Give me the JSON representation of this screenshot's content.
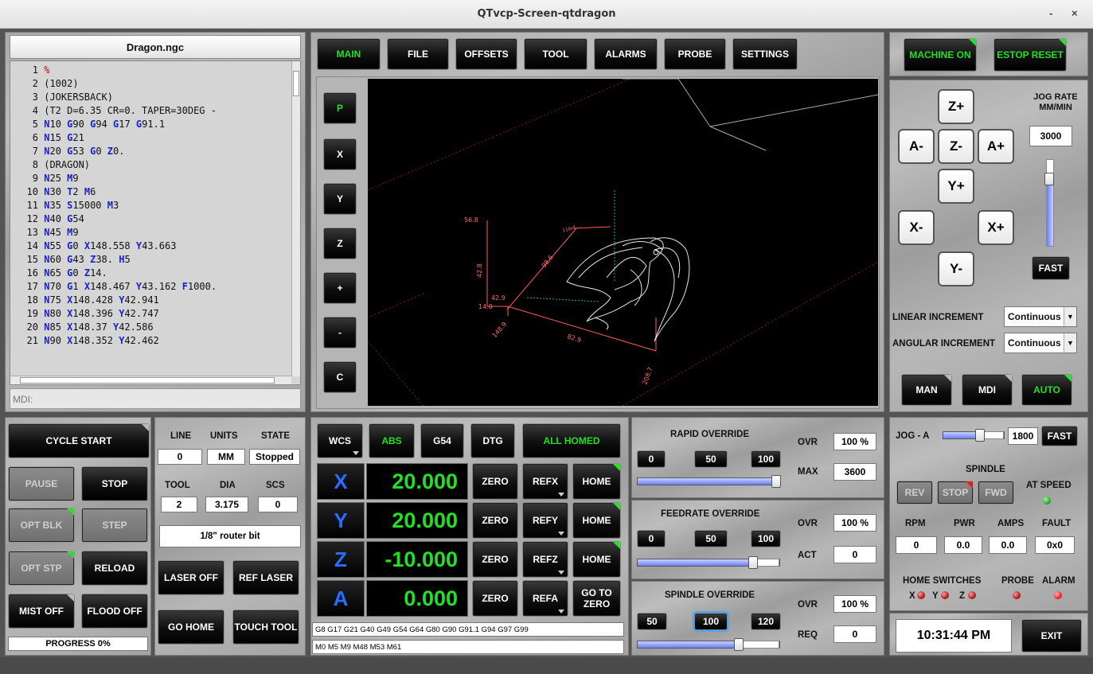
{
  "window": {
    "title": "QTvcp-Screen-qtdragon",
    "minimize": "-",
    "close": "×"
  },
  "gcode": {
    "filename": "Dragon.ngc",
    "lines": [
      {
        "n": "1",
        "t": [
          [
            "pct",
            "%"
          ]
        ]
      },
      {
        "n": "2",
        "t": [
          [
            "",
            "(1002)"
          ]
        ]
      },
      {
        "n": "3",
        "t": [
          [
            "",
            "(JOKERSBACK)"
          ]
        ]
      },
      {
        "n": "4",
        "t": [
          [
            "",
            "(T2  D=6.35 CR=0. TAPER=30DEG -"
          ]
        ]
      },
      {
        "n": "5",
        "t": [
          [
            "kw",
            "N"
          ],
          [
            "",
            "10 "
          ],
          [
            "kw",
            "G"
          ],
          [
            "",
            "90 "
          ],
          [
            "kw",
            "G"
          ],
          [
            "",
            "94 "
          ],
          [
            "kw",
            "G"
          ],
          [
            "",
            "17 "
          ],
          [
            "kw",
            "G"
          ],
          [
            "",
            "91.1"
          ]
        ]
      },
      {
        "n": "6",
        "t": [
          [
            "kw",
            "N"
          ],
          [
            "",
            "15 "
          ],
          [
            "kw",
            "G"
          ],
          [
            "",
            "21"
          ]
        ]
      },
      {
        "n": "7",
        "t": [
          [
            "kw",
            "N"
          ],
          [
            "",
            "20 "
          ],
          [
            "kw",
            "G"
          ],
          [
            "",
            "53 "
          ],
          [
            "kw",
            "G"
          ],
          [
            "",
            "0 "
          ],
          [
            "kw",
            "Z"
          ],
          [
            "",
            "0."
          ]
        ]
      },
      {
        "n": "8",
        "t": [
          [
            "",
            "(DRAGON)"
          ]
        ]
      },
      {
        "n": "9",
        "t": [
          [
            "kw",
            "N"
          ],
          [
            "",
            "25 "
          ],
          [
            "kw",
            "M"
          ],
          [
            "",
            "9"
          ]
        ]
      },
      {
        "n": "10",
        "t": [
          [
            "kw",
            "N"
          ],
          [
            "",
            "30 "
          ],
          [
            "kw",
            "T"
          ],
          [
            "",
            "2 "
          ],
          [
            "kw",
            "M"
          ],
          [
            "",
            "6"
          ]
        ]
      },
      {
        "n": "11",
        "t": [
          [
            "kw",
            "N"
          ],
          [
            "",
            "35 "
          ],
          [
            "kw",
            "S"
          ],
          [
            "",
            "15000 "
          ],
          [
            "kw",
            "M"
          ],
          [
            "",
            "3"
          ]
        ]
      },
      {
        "n": "12",
        "t": [
          [
            "kw",
            "N"
          ],
          [
            "",
            "40 "
          ],
          [
            "kw",
            "G"
          ],
          [
            "",
            "54"
          ]
        ]
      },
      {
        "n": "13",
        "t": [
          [
            "kw",
            "N"
          ],
          [
            "",
            "45 "
          ],
          [
            "kw",
            "M"
          ],
          [
            "",
            "9"
          ]
        ]
      },
      {
        "n": "14",
        "t": [
          [
            "kw",
            "N"
          ],
          [
            "",
            "55 "
          ],
          [
            "kw",
            "G"
          ],
          [
            "",
            "0 "
          ],
          [
            "kw",
            "X"
          ],
          [
            "",
            "148.558 "
          ],
          [
            "kw",
            "Y"
          ],
          [
            "",
            "43.663"
          ]
        ]
      },
      {
        "n": "15",
        "t": [
          [
            "kw",
            "N"
          ],
          [
            "",
            "60 "
          ],
          [
            "kw",
            "G"
          ],
          [
            "",
            "43 "
          ],
          [
            "kw",
            "Z"
          ],
          [
            "",
            "38. "
          ],
          [
            "kw",
            "H"
          ],
          [
            "",
            "5"
          ]
        ]
      },
      {
        "n": "16",
        "t": [
          [
            "kw",
            "N"
          ],
          [
            "",
            "65 "
          ],
          [
            "kw",
            "G"
          ],
          [
            "",
            "0 "
          ],
          [
            "kw",
            "Z"
          ],
          [
            "",
            "14."
          ]
        ]
      },
      {
        "n": "17",
        "t": [
          [
            "kw",
            "N"
          ],
          [
            "",
            "70 "
          ],
          [
            "kw",
            "G"
          ],
          [
            "",
            "1 "
          ],
          [
            "kw",
            "X"
          ],
          [
            "",
            "148.467 "
          ],
          [
            "kw",
            "Y"
          ],
          [
            "",
            "43.162 "
          ],
          [
            "kw",
            "F"
          ],
          [
            "",
            "1000."
          ]
        ]
      },
      {
        "n": "18",
        "t": [
          [
            "kw",
            "N"
          ],
          [
            "",
            "75 "
          ],
          [
            "kw",
            "X"
          ],
          [
            "",
            "148.428 "
          ],
          [
            "kw",
            "Y"
          ],
          [
            "",
            "42.941"
          ]
        ]
      },
      {
        "n": "19",
        "t": [
          [
            "kw",
            "N"
          ],
          [
            "",
            "80 "
          ],
          [
            "kw",
            "X"
          ],
          [
            "",
            "148.396 "
          ],
          [
            "kw",
            "Y"
          ],
          [
            "",
            "42.747"
          ]
        ]
      },
      {
        "n": "20",
        "t": [
          [
            "kw",
            "N"
          ],
          [
            "",
            "85 "
          ],
          [
            "kw",
            "X"
          ],
          [
            "",
            "148.37 "
          ],
          [
            "kw",
            "Y"
          ],
          [
            "",
            "42.586"
          ]
        ]
      },
      {
        "n": "21",
        "t": [
          [
            "kw",
            "N"
          ],
          [
            "",
            "90 "
          ],
          [
            "kw",
            "X"
          ],
          [
            "",
            "148.352 "
          ],
          [
            "kw",
            "Y"
          ],
          [
            "",
            "42.462"
          ]
        ]
      }
    ],
    "mdi_label": "MDI:"
  },
  "tabs": [
    "MAIN",
    "FILE",
    "OFFSETS",
    "TOOL",
    "ALARMS",
    "PROBE",
    "SETTINGS"
  ],
  "view_buttons": [
    "P",
    "X",
    "Y",
    "Z",
    "+",
    "-",
    "C"
  ],
  "preview": {
    "dims": [
      "56.8",
      "42.8",
      "98.6",
      "14.0",
      "42.9",
      "148.9",
      "82.9",
      "208.7",
      "116.7"
    ]
  },
  "machine": {
    "on": "MACHINE ON",
    "estop": "ESTOP RESET"
  },
  "jog": {
    "rate_label": "JOG RATE MM/MIN",
    "rate_value": "3000",
    "fast": "FAST",
    "buttons": {
      "zp": "Z+",
      "zm": "Z-",
      "am": "A-",
      "ap": "A+",
      "yp": "Y+",
      "ym": "Y-",
      "xm": "X-",
      "xp": "X+"
    },
    "rate_level": 0.83,
    "linear_label": "LINEAR INCREMENT",
    "linear_value": "Continuous",
    "angular_label": "ANGULAR INCREMENT",
    "angular_value": "Continuous"
  },
  "modes": {
    "man": "MAN",
    "mdi": "MDI",
    "auto": "AUTO"
  },
  "left_controls": {
    "cycle_start": "CYCLE START",
    "pause": "PAUSE",
    "stop": "STOP",
    "opt_blk": "OPT BLK",
    "step": "STEP",
    "opt_stp": "OPT STP",
    "reload": "RELOAD",
    "mist": "MIST OFF",
    "flood": "FLOOD OFF",
    "progress": "PROGRESS 0%"
  },
  "status": {
    "line_label": "LINE",
    "line": "0",
    "units_label": "UNITS",
    "units": "MM",
    "state_label": "STATE",
    "state": "Stopped",
    "tool_label": "TOOL",
    "tool": "2",
    "dia_label": "DIA",
    "dia": "3.175",
    "scs_label": "SCS",
    "scs": "0",
    "tool_desc": "1/8\" router bit",
    "laser": "LASER OFF",
    "ref_laser": "REF LASER",
    "go_home": "GO HOME",
    "touch_tool": "TOUCH TOOL"
  },
  "dro": {
    "wcs": "WCS",
    "abs": "ABS",
    "g54": "G54",
    "dtg": "DTG",
    "homed": "ALL HOMED",
    "axes": [
      {
        "name": "X",
        "value": "20.000",
        "zero": "ZERO",
        "ref": "REFX",
        "home": "HOME"
      },
      {
        "name": "Y",
        "value": "20.000",
        "zero": "ZERO",
        "ref": "REFY",
        "home": "HOME"
      },
      {
        "name": "Z",
        "value": "-10.000",
        "zero": "ZERO",
        "ref": "REFZ",
        "home": "HOME"
      },
      {
        "name": "A",
        "value": "0.000",
        "zero": "ZERO",
        "ref": "REFA",
        "home": "GO TO ZERO"
      }
    ],
    "gcodes": "G8 G17 G21 G40 G49 G54 G64 G80 G90 G91.1 G94 G97 G99",
    "mcodes": "M0 M5 M9 M48 M53 M61"
  },
  "overrides": {
    "rapid": {
      "title": "RAPID OVERRIDE",
      "b1": "0",
      "b2": "50",
      "b3": "100",
      "ovr_label": "OVR",
      "ovr": "100 %",
      "max_label": "MAX",
      "max": "3600",
      "level": 1.0
    },
    "feed": {
      "title": "FEEDRATE OVERRIDE",
      "b1": "0",
      "b2": "50",
      "b3": "100",
      "ovr_label": "OVR",
      "ovr": "100 %",
      "act_label": "ACT",
      "act": "0",
      "level": 0.83
    },
    "spindle": {
      "title": "SPINDLE OVERRIDE",
      "b1": "50",
      "b2": "100",
      "b3": "120",
      "ovr_label": "OVR",
      "ovr": "100 %",
      "req_label": "REQ",
      "req": "0",
      "level": 0.72
    }
  },
  "spindle_panel": {
    "jog_a_label": "JOG - A",
    "jog_a_value": "1800",
    "fast": "FAST",
    "jog_a_level": 0.6,
    "title": "SPINDLE",
    "rev": "REV",
    "stop": "STOP",
    "fwd": "FWD",
    "at_speed": "AT SPEED",
    "rpm_label": "RPM",
    "pwr_label": "PWR",
    "amps_label": "AMPS",
    "fault_label": "FAULT",
    "rpm": "0",
    "pwr": "0.0",
    "amps": "0.0",
    "fault": "0x0",
    "home_switches": "HOME SWITCHES",
    "probe": "PROBE",
    "alarm": "ALARM",
    "hx": "X",
    "hy": "Y",
    "hz": "Z"
  },
  "clock": "10:31:44 PM",
  "exit": "EXIT",
  "colors": {
    "green": "#24e024",
    "blue": "#2a6cff",
    "led_green": "#3aa63a",
    "led_red": "#e02020"
  }
}
